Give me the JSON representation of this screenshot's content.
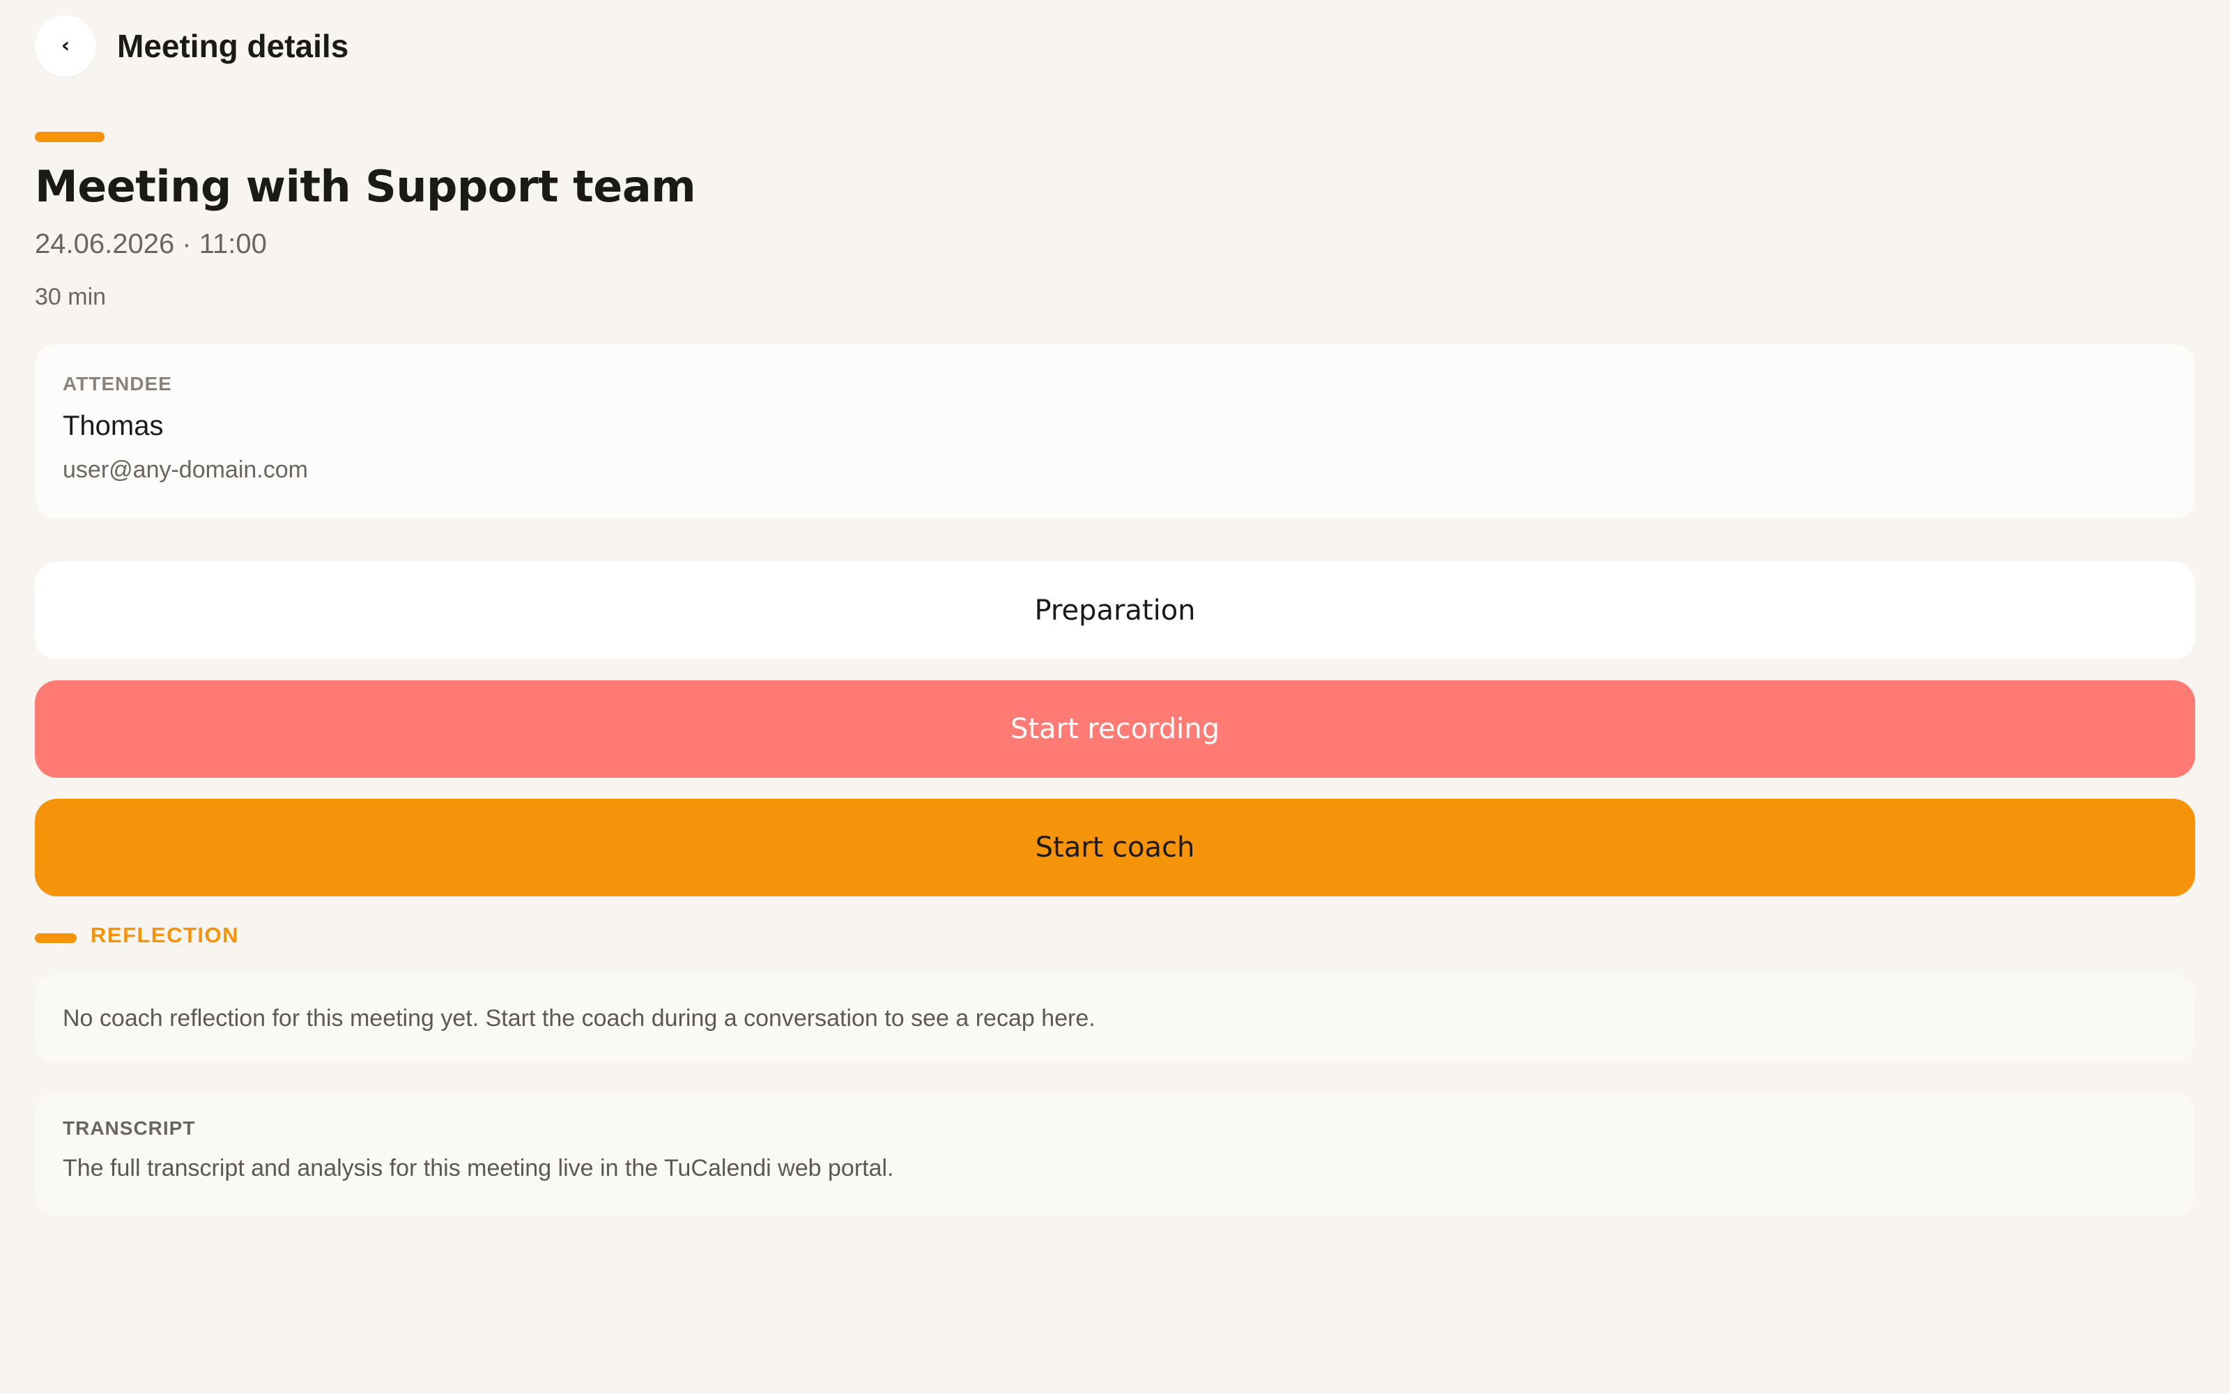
{
  "header": {
    "back_icon": "chevron-left-icon",
    "back_glyph": "‹",
    "title": "Meeting details"
  },
  "meeting": {
    "title": "Meeting with Support team",
    "datetime": "24.06.2026 · 11:00",
    "duration": "30 min"
  },
  "attendee": {
    "label": "ATTENDEE",
    "name": "Thomas",
    "email": "user@any-domain.com"
  },
  "actions": {
    "preparation_label": "Preparation",
    "start_recording_label": "Start recording",
    "start_coach_label": "Start coach"
  },
  "reflection": {
    "label": "REFLECTION",
    "empty_text": "No coach reflection for this meeting yet. Start the coach during a conversation to see a recap here."
  },
  "transcript": {
    "label": "TRANSCRIPT",
    "text": "The full transcript and analysis for this meeting live in the TuCalendi web portal."
  },
  "colors": {
    "accent": "#f5930a",
    "recording": "#ff7b74",
    "background": "#f8f5f1"
  }
}
